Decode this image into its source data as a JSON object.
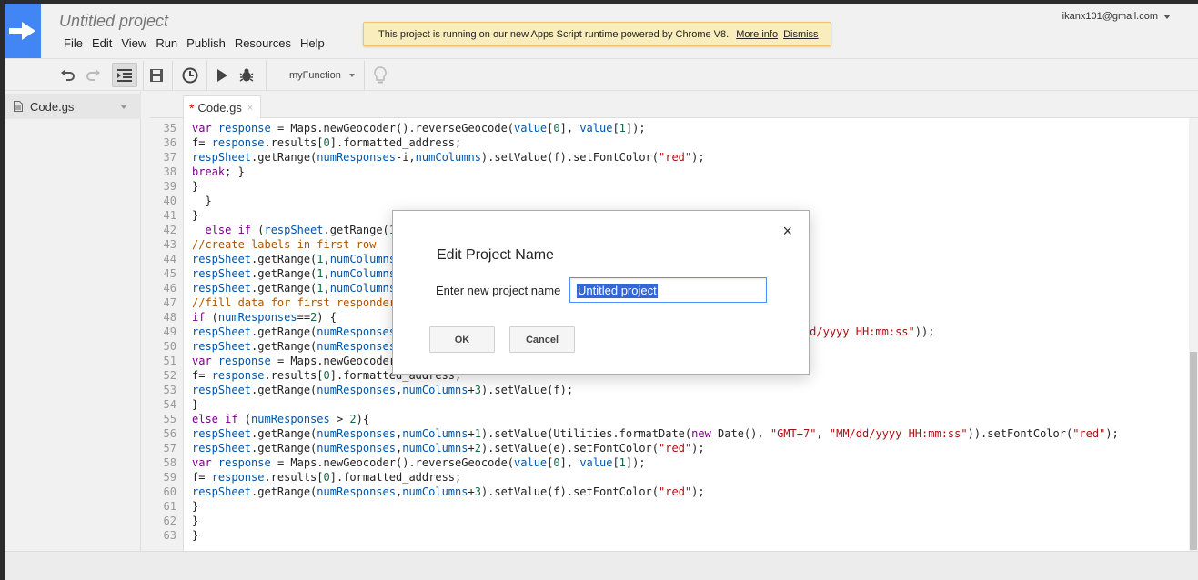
{
  "project": {
    "title": "Untitled project"
  },
  "menu": [
    "File",
    "Edit",
    "View",
    "Run",
    "Publish",
    "Resources",
    "Help"
  ],
  "account": {
    "email": "ikanx101@gmail.com"
  },
  "notice": {
    "message": "This project is running on our new Apps Script runtime powered by Chrome V8.",
    "more_info": "More info",
    "dismiss": "Dismiss"
  },
  "toolbar": {
    "function_name": "myFunction"
  },
  "sidebar": {
    "file_name": "Code.gs"
  },
  "tab": {
    "name": "Code.gs",
    "modified_marker": "*",
    "close": "×"
  },
  "code_lines": [
    {
      "n": "35",
      "html": "<span class=\"kw\">var</span> <span class=\"vr\">response</span> = Maps.newGeocoder().reverseGeocode(<span class=\"vr\">value</span>[<span class=\"num\">0</span>], <span class=\"vr\">value</span>[<span class=\"num\">1</span>]);"
    },
    {
      "n": "36",
      "html": "f= <span class=\"vr\">response</span>.results[<span class=\"num\">0</span>].formatted_address;"
    },
    {
      "n": "37",
      "html": "<span class=\"vr\">respSheet</span>.getRange(<span class=\"vr\">numResponses</span>-i,<span class=\"vr\">numColumns</span>).setValue(f).setFontColor(<span class=\"str\">\"red\"</span>);"
    },
    {
      "n": "38",
      "html": "<span class=\"kw\">break</span>; }"
    },
    {
      "n": "39",
      "html": "}"
    },
    {
      "n": "40",
      "html": "  }"
    },
    {
      "n": "41",
      "html": "}"
    },
    {
      "n": "42",
      "html": "  <span class=\"kw\">else if</span> (<span class=\"vr\">respSheet</span>.getRange(<span class=\"num\">1</span>"
    },
    {
      "n": "43",
      "html": "<span class=\"cmt\">//create labels in first row</span>"
    },
    {
      "n": "44",
      "html": "<span class=\"vr\">respSheet</span>.getRange(<span class=\"num\">1</span>,<span class=\"vr\">numColumns</span>"
    },
    {
      "n": "45",
      "html": "<span class=\"vr\">respSheet</span>.getRange(<span class=\"num\">1</span>,<span class=\"vr\">numColumns</span>"
    },
    {
      "n": "46",
      "html": "<span class=\"vr\">respSheet</span>.getRange(<span class=\"num\">1</span>,<span class=\"vr\">numColumns</span>"
    },
    {
      "n": "47",
      "html": "<span class=\"cmt\">//fill data for first responder</span>"
    },
    {
      "n": "48",
      "html": "<span class=\"kw\">if</span> (<span class=\"vr\">numResponses</span>==<span class=\"num\">2</span>) {"
    },
    {
      "n": "49",
      "html": "<span class=\"vr\">respSheet</span>.getRange(<span class=\"vr\">numResponses</span>                                                       <span class=\"str\">\"</span>, <span class=\"str\">\"MM/dd/yyyy HH:mm:ss\"</span>));"
    },
    {
      "n": "50",
      "html": "<span class=\"vr\">respSheet</span>.getRange(<span class=\"vr\">numResponses</span>"
    },
    {
      "n": "51",
      "html": "<span class=\"kw\">var</span> <span class=\"vr\">response</span> = Maps.newGeocoder"
    },
    {
      "n": "52",
      "html": "f= <span class=\"vr\">response</span>.results[<span class=\"num\">0</span>].formatted_address;"
    },
    {
      "n": "53",
      "html": "<span class=\"vr\">respSheet</span>.getRange(<span class=\"vr\">numResponses</span>,<span class=\"vr\">numColumns</span>+<span class=\"num\">3</span>).setValue(f);"
    },
    {
      "n": "54",
      "html": "}"
    },
    {
      "n": "55",
      "html": "<span class=\"kw\">else if</span> (<span class=\"vr\">numResponses</span> &gt; <span class=\"num\">2</span>){"
    },
    {
      "n": "56",
      "html": "<span class=\"vr\">respSheet</span>.getRange(<span class=\"vr\">numResponses</span>,<span class=\"vr\">numColumns</span>+<span class=\"num\">1</span>).setValue(Utilities.formatDate(<span class=\"kw\">new</span> Date(), <span class=\"str\">\"GMT+7\"</span>, <span class=\"str\">\"MM/dd/yyyy HH:mm:ss\"</span>)).setFontColor(<span class=\"str\">\"red\"</span>);"
    },
    {
      "n": "57",
      "html": "<span class=\"vr\">respSheet</span>.getRange(<span class=\"vr\">numResponses</span>,<span class=\"vr\">numColumns</span>+<span class=\"num\">2</span>).setValue(e).setFontColor(<span class=\"str\">\"red\"</span>);"
    },
    {
      "n": "58",
      "html": "<span class=\"kw\">var</span> <span class=\"vr\">response</span> = Maps.newGeocoder().reverseGeocode(<span class=\"vr\">value</span>[<span class=\"num\">0</span>], <span class=\"vr\">value</span>[<span class=\"num\">1</span>]);"
    },
    {
      "n": "59",
      "html": "f= <span class=\"vr\">response</span>.results[<span class=\"num\">0</span>].formatted_address;"
    },
    {
      "n": "60",
      "html": "<span class=\"vr\">respSheet</span>.getRange(<span class=\"vr\">numResponses</span>,<span class=\"vr\">numColumns</span>+<span class=\"num\">3</span>).setValue(f).setFontColor(<span class=\"str\">\"red\"</span>);"
    },
    {
      "n": "61",
      "html": "}"
    },
    {
      "n": "62",
      "html": "}"
    },
    {
      "n": "63",
      "html": "}"
    }
  ],
  "dialog": {
    "title": "Edit Project Name",
    "label": "Enter new project name",
    "input_value": "Untitled project",
    "ok_label": "OK",
    "cancel_label": "Cancel",
    "close": "×"
  },
  "icons": {
    "logo": "arrow-right-icon",
    "undo": "undo-icon",
    "redo": "redo-icon",
    "indent": "indent-icon",
    "save": "save-icon",
    "triggers": "clock-icon",
    "run": "play-icon",
    "debug": "bug-icon",
    "hint": "lightbulb-icon",
    "file": "document-icon"
  },
  "colors": {
    "accent": "#4285f4",
    "notice_bg": "#f9edbe",
    "selection": "#3367d6"
  }
}
